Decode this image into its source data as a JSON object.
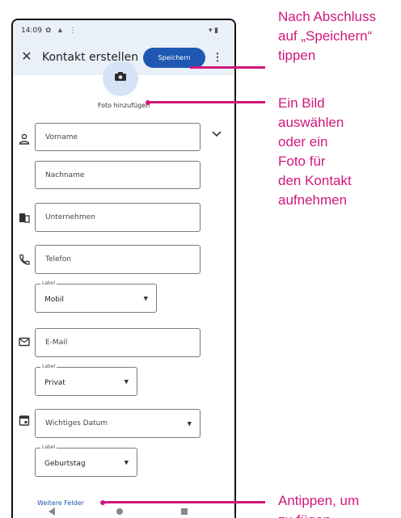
{
  "status_bar": {
    "time": "14:09",
    "left_icons": "✿ ▲ ⋮",
    "right_icons": "▾ ▮"
  },
  "app_bar": {
    "close_glyph": "✕",
    "title": "Kontakt erstellen",
    "save_label": "Speichern",
    "menu_glyph": "⋮"
  },
  "photo": {
    "label": "Foto hinzufügen"
  },
  "fields": {
    "first_name": {
      "placeholder": "Vorname"
    },
    "last_name": {
      "placeholder": "Nachname"
    },
    "company": {
      "placeholder": "Unternehmen"
    },
    "phone": {
      "placeholder": "Telefon"
    },
    "phone_label": {
      "float_label": "Label",
      "value": "Mobil"
    },
    "email": {
      "placeholder": "E-Mail"
    },
    "email_label": {
      "float_label": "Label",
      "value": "Privat"
    },
    "date": {
      "placeholder": "Wichtiges Datum"
    },
    "date_label": {
      "float_label": "Label",
      "value": "Geburtstag"
    }
  },
  "more_fields_label": "Weitere Felder",
  "callouts": {
    "save": "Nach Abschluss\nauf „Speichern“\ntippen",
    "photo": "Ein Bild\nauswählen\noder ein\nFoto für\nden Kontakt\naufnehmen",
    "more": "Antippen, um\nzu fügen"
  },
  "colors": {
    "accent": "#1f58b3",
    "callout": "#d0177d",
    "header_bg": "#eaf0f8"
  }
}
